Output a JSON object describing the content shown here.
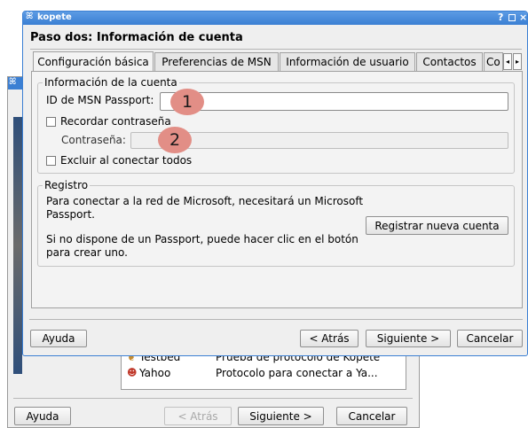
{
  "back_window": {
    "list_rows": [
      {
        "icon": "testbed-icon",
        "name": "Testbed",
        "desc": "Prueba de protocolo de Kopete"
      },
      {
        "icon": "yahoo-icon",
        "name": "Yahoo",
        "desc": "Protocolo para conectar a Ya..."
      }
    ],
    "buttons": {
      "help": "Ayuda",
      "back": "< Atrás",
      "next": "Siguiente >",
      "cancel": "Cancelar"
    }
  },
  "dialog": {
    "title": "kopete",
    "titlebar_controls": "?",
    "heading": "Paso dos: Información de cuenta",
    "tabs": [
      {
        "label": "Configuración básica",
        "active": true
      },
      {
        "label": "Preferencias de MSN",
        "active": false
      },
      {
        "label": "Información de usuario",
        "active": false
      },
      {
        "label": "Contactos",
        "active": false
      },
      {
        "label": "Co",
        "active": false
      }
    ],
    "account_group": {
      "legend": "Información de la cuenta",
      "passport_label": "ID de MSN Passport:",
      "passport_value": "",
      "remember_label": "Recordar contraseña",
      "remember_checked": false,
      "password_label": "Contraseña:",
      "password_value": "",
      "exclude_label": "Excluir al conectar todos",
      "exclude_checked": false
    },
    "register_group": {
      "legend": "Registro",
      "text1": "Para conectar a la red de Microsoft, necesitará un Microsoft Passport.",
      "text2": "Si no dispone de un Passport, puede hacer clic en el botón para crear uno.",
      "register_button": "Registrar nueva cuenta"
    },
    "buttons": {
      "help": "Ayuda",
      "back": "< Atrás",
      "next": "Siguiente >",
      "cancel": "Cancelar"
    }
  },
  "annotations": [
    "1",
    "2"
  ],
  "colors": {
    "titlebar": "#3b7fd3",
    "dialog_bg": "#efefef",
    "badge": "#e28e86"
  }
}
